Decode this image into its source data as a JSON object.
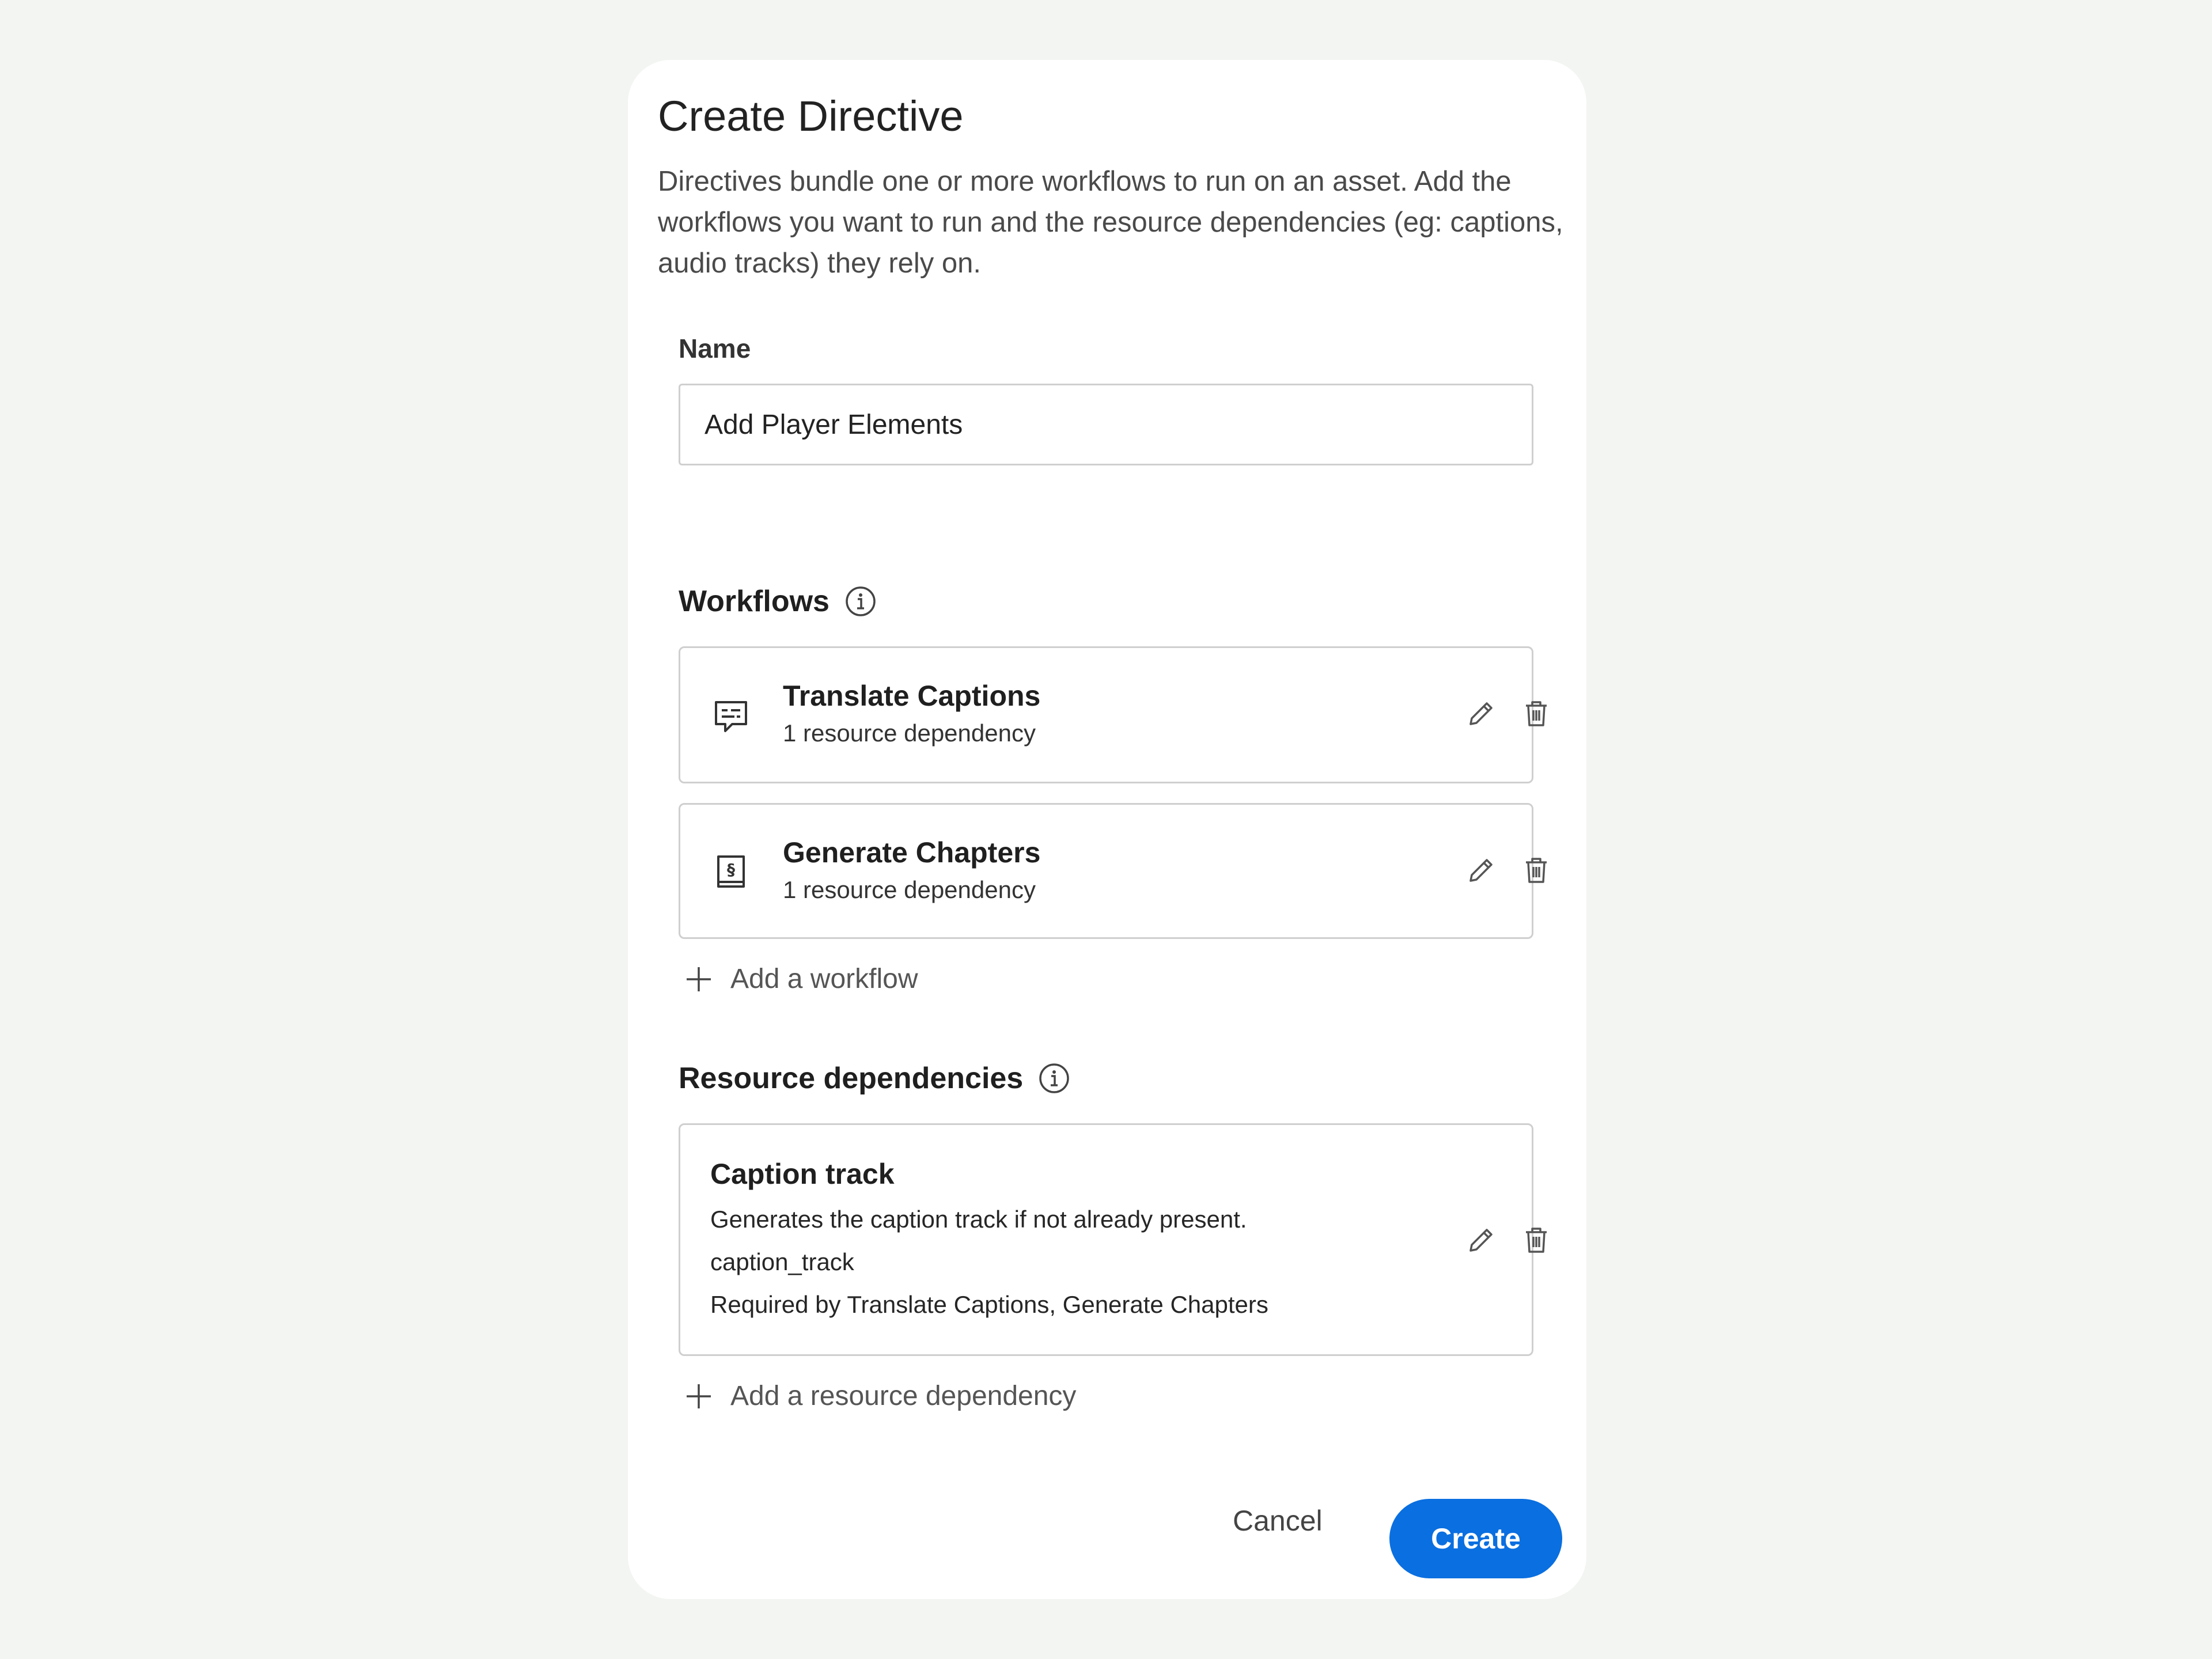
{
  "dialog": {
    "title": "Create Directive",
    "description": "Directives bundle one or more workflows to run on an asset. Add the workflows you want to run and the resource dependencies (eg: captions, audio tracks) they rely on."
  },
  "name_field": {
    "label": "Name",
    "value": "Add Player Elements"
  },
  "workflows": {
    "heading": "Workflows",
    "items": [
      {
        "icon": "captions-icon",
        "title": "Translate Captions",
        "subtitle": "1 resource dependency"
      },
      {
        "icon": "chapters-icon",
        "title": "Generate Chapters",
        "subtitle": "1 resource dependency"
      }
    ],
    "add_label": "Add a workflow"
  },
  "resources": {
    "heading": "Resource dependencies",
    "items": [
      {
        "title": "Caption track",
        "description": "Generates the caption track if not already present.",
        "key": "caption_track",
        "required_by": "Required by Translate Captions, Generate Chapters"
      }
    ],
    "add_label": "Add a resource dependency"
  },
  "footer": {
    "cancel_label": "Cancel",
    "create_label": "Create"
  },
  "colors": {
    "background": "#f3f5f2",
    "primary": "#0a6fe0",
    "border": "#cfcfcf"
  }
}
